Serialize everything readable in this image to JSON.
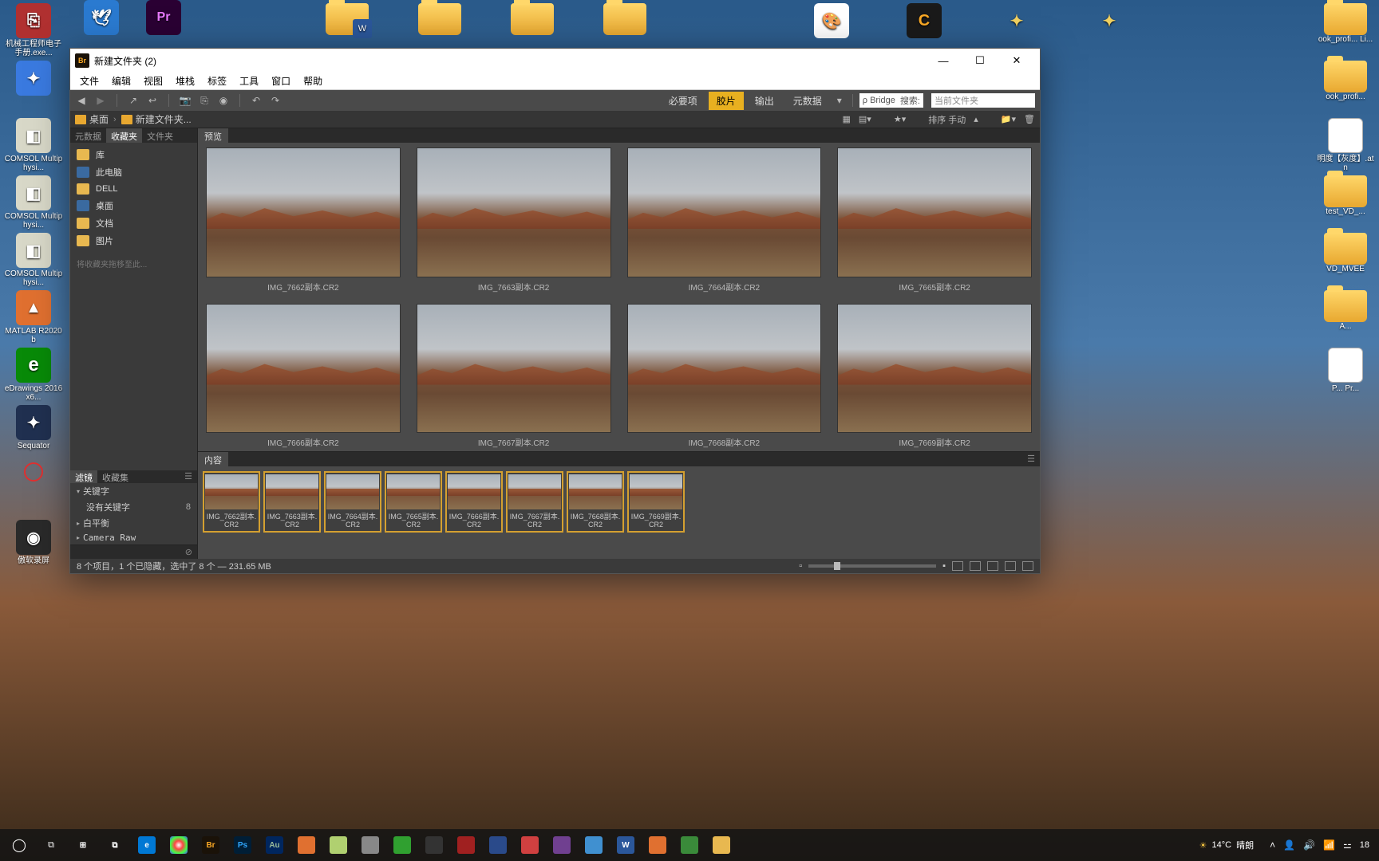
{
  "desktop_left": [
    {
      "label": "机械工程师电子手册.exe...",
      "color": "#b03030"
    },
    {
      "label": "",
      "color": "#3a7ae0"
    },
    {
      "label": "COMSOL Multiphysi...",
      "color": "#d8d8c8"
    },
    {
      "label": "COMSOL Multiphysi...",
      "color": "#d8d8c8"
    },
    {
      "label": "COMSOL Multiphysi...",
      "color": "#d8d8c8"
    },
    {
      "label": "MATLAB    R2020b",
      "color": "#e07030"
    },
    {
      "label": "eDrawings 2016 x6...",
      "color": "#3a8a3a"
    },
    {
      "label": "Sequator",
      "color": "#203050"
    },
    {
      "label": "",
      "color": "#000"
    },
    {
      "label": "傲软录屏",
      "color": "#2a2a2a"
    }
  ],
  "desktop_right": [
    {
      "label": "ook_profi... Li..."
    },
    {
      "label": "ook_profi..."
    },
    {
      "label": "明度【灰度】.atn"
    },
    {
      "label": "test_VD_..."
    },
    {
      "label": "VD_MVEE"
    },
    {
      "label": "A..."
    },
    {
      "label": "P... Pr..."
    }
  ],
  "title": "新建文件夹 (2)",
  "menu": [
    "文件",
    "编辑",
    "视图",
    "堆栈",
    "标签",
    "工具",
    "窗口",
    "帮助"
  ],
  "workspace": {
    "req": "必要项",
    "film": "胶片",
    "output": "输出",
    "meta": "元数据"
  },
  "search_prefix": "ρ Bridge",
  "search_label": "搜索:",
  "search_ph": "当前文件夹",
  "path": {
    "desktop": "桌面",
    "folder": "新建文件夹..."
  },
  "sort_label": "排序 手动",
  "left_tabs": {
    "meta": "元数据",
    "fav": "收藏夹",
    "folder": "文件夹"
  },
  "preview_tab": "预览",
  "favorites": [
    {
      "label": "库",
      "color": "#e8b850"
    },
    {
      "label": "此电脑",
      "color": "#3a6aa0"
    },
    {
      "label": "DELL",
      "color": "#e8b850"
    },
    {
      "label": "桌面",
      "color": "#3a6aa0"
    },
    {
      "label": "文档",
      "color": "#e8b850"
    },
    {
      "label": "图片",
      "color": "#e8b850"
    }
  ],
  "fav_hint": "将收藏夹拖移至此...",
  "filter_tabs": {
    "filter": "滤镜",
    "collections": "收藏集"
  },
  "filters": {
    "kw": "关键字",
    "nokw": "没有关键字",
    "nokw_cnt": "8",
    "wb": "白平衡",
    "craw": "Camera Raw"
  },
  "thumbs": [
    "IMG_7662副本.CR2",
    "IMG_7663副本.CR2",
    "IMG_7664副本.CR2",
    "IMG_7665副本.CR2",
    "IMG_7666副本.CR2",
    "IMG_7667副本.CR2",
    "IMG_7668副本.CR2",
    "IMG_7669副本.CR2"
  ],
  "content_tab": "内容",
  "strip": [
    "IMG_7662副本.CR2",
    "IMG_7663副本.CR2",
    "IMG_7664副本.CR2",
    "IMG_7665副本.CR2",
    "IMG_7666副本.CR2",
    "IMG_7667副本.CR2",
    "IMG_7668副本.CR2",
    "IMG_7669副本.CR2"
  ],
  "status": "8 个项目，1 个已隐藏，选中了 8 个 — 231.65 MB",
  "weather": {
    "temp": "14°C",
    "cond": "晴朗"
  },
  "clock": "18",
  "tb_apps": [
    {
      "t": "⊞",
      "bg": "transparent",
      "c": "#fff"
    },
    {
      "t": "⧉",
      "bg": "transparent",
      "c": "#fff"
    },
    {
      "t": "e",
      "bg": "#0078d4",
      "c": "#fff"
    },
    {
      "t": "",
      "bg": "radial-gradient(circle,#fff,#f44,#4f4,#44f)",
      "c": ""
    },
    {
      "t": "Br",
      "bg": "#1a1208",
      "c": "#f9a825"
    },
    {
      "t": "Ps",
      "bg": "#001e36",
      "c": "#31a8ff"
    },
    {
      "t": "Au",
      "bg": "#00265e",
      "c": "#9b9"
    },
    {
      "t": "",
      "bg": "#e07030",
      "c": ""
    },
    {
      "t": "",
      "bg": "#b0d070",
      "c": ""
    },
    {
      "t": "",
      "bg": "#888",
      "c": ""
    },
    {
      "t": "",
      "bg": "#30a030",
      "c": ""
    },
    {
      "t": "",
      "bg": "#333",
      "c": "#fff"
    },
    {
      "t": "",
      "bg": "#a02020",
      "c": ""
    },
    {
      "t": "",
      "bg": "#2a4a8a",
      "c": ""
    },
    {
      "t": "",
      "bg": "#d04040",
      "c": ""
    },
    {
      "t": "",
      "bg": "#704090",
      "c": ""
    },
    {
      "t": "",
      "bg": "#4090d0",
      "c": ""
    },
    {
      "t": "W",
      "bg": "#2b579a",
      "c": "#fff"
    },
    {
      "t": "",
      "bg": "#e07030",
      "c": ""
    },
    {
      "t": "",
      "bg": "#3a8a3a",
      "c": ""
    },
    {
      "t": "",
      "bg": "#e8b850",
      "c": ""
    }
  ]
}
